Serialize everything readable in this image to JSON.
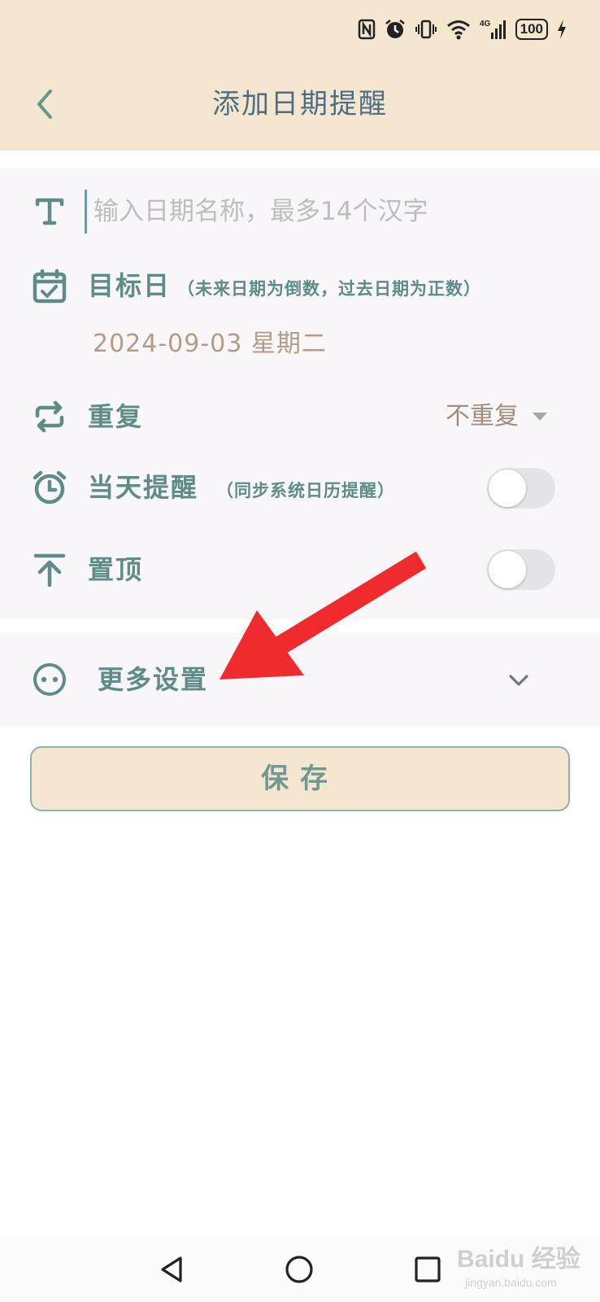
{
  "status_bar": {
    "battery": "100",
    "network": "4G"
  },
  "header": {
    "title": "添加日期提醒"
  },
  "form": {
    "name_placeholder": "输入日期名称，最多14个汉字",
    "target_label": "目标日",
    "target_hint": "（未来日期为倒数，过去日期为正数）",
    "target_date": "2024-09-03 星期二",
    "repeat_label": "重复",
    "repeat_value": "不重复",
    "reminder_label": "当天提醒",
    "reminder_hint": "（同步系统日历提醒）",
    "reminder_on": false,
    "pin_label": "置顶",
    "pin_on": false
  },
  "more": {
    "label": "更多设置"
  },
  "save": {
    "label": "保存"
  },
  "watermark": {
    "brand": "Baidu 经验",
    "url": "jingyan.baidu.com"
  },
  "colors": {
    "header_bg": "#f5e6cf",
    "accent": "#5e8c86",
    "date": "#b49b83",
    "arrow": "#ef2b2d"
  }
}
